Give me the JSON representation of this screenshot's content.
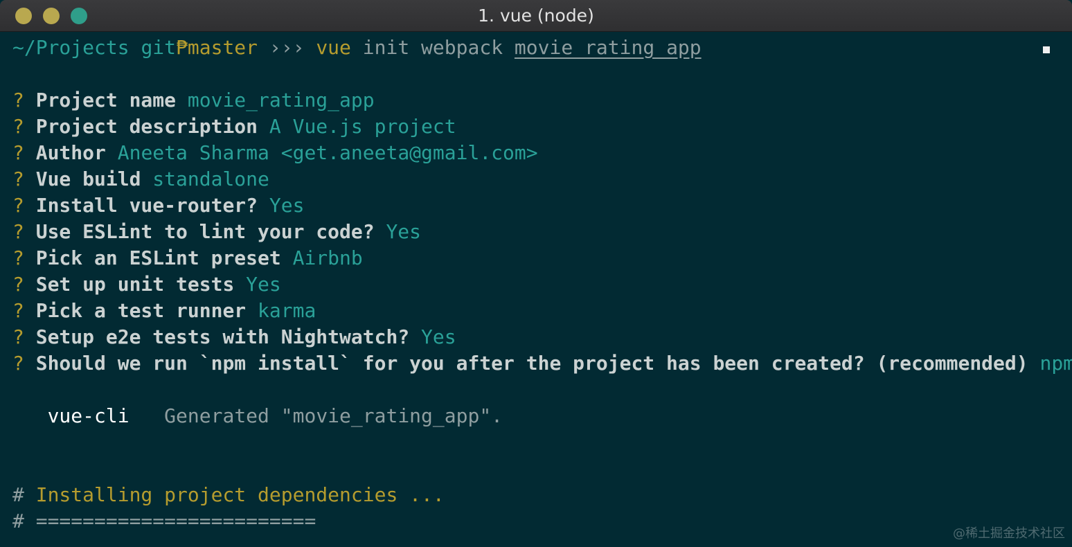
{
  "window": {
    "title": "1. vue (node)"
  },
  "prompt": {
    "cwd": "~/Projects",
    "git": "git",
    "branch_glyph": "₱",
    "branch": "master",
    "arrows": "›››",
    "command_vue": "vue",
    "command_args": "init webpack",
    "project_arg": "movie_rating_app"
  },
  "questions": [
    {
      "mark": "?",
      "label": "Project name",
      "answer": "movie_rating_app"
    },
    {
      "mark": "?",
      "label": "Project description",
      "answer": "A Vue.js project"
    },
    {
      "mark": "?",
      "label": "Author",
      "answer": "Aneeta Sharma <get.aneeta@gmail.com>"
    },
    {
      "mark": "?",
      "label": "Vue build",
      "answer": "standalone"
    },
    {
      "mark": "?",
      "label": "Install vue-router?",
      "answer": "Yes"
    },
    {
      "mark": "?",
      "label": "Use ESLint to lint your code?",
      "answer": "Yes"
    },
    {
      "mark": "?",
      "label": "Pick an ESLint preset",
      "answer": "Airbnb"
    },
    {
      "mark": "?",
      "label": "Set up unit tests",
      "answer": "Yes"
    },
    {
      "mark": "?",
      "label": "Pick a test runner",
      "answer": "karma"
    },
    {
      "mark": "?",
      "label": "Setup e2e tests with Nightwatch?",
      "answer": "Yes"
    },
    {
      "mark": "?",
      "label": "Should we run `npm install` for you after the project has been created? (recommended)",
      "answer": "npm"
    }
  ],
  "generated": {
    "tool": "vue-cli",
    "message": "Generated \"movie_rating_app\"."
  },
  "installing": {
    "hash": "#",
    "text": "Installing project dependencies ...",
    "rule": "========================"
  },
  "watermark": "@稀土掘金技术社区",
  "colors": {
    "background": "#022a33",
    "yellow": "#b59c2e",
    "cyan": "#2aa198",
    "gray": "#8f9ea0"
  }
}
